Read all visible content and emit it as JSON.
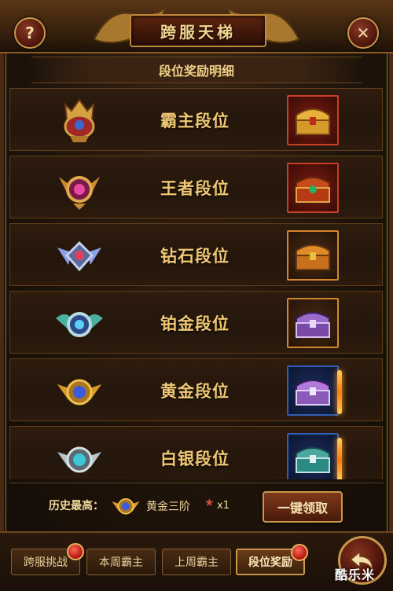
{
  "window": {
    "title": "跨服天梯"
  },
  "section": {
    "title": "段位奖励明细"
  },
  "ranks": [
    {
      "label": "霸主段位",
      "emblem": "overlord-emblem-icon",
      "chest": "gold-chest-icon",
      "frame": "red"
    },
    {
      "label": "王者段位",
      "emblem": "king-emblem-icon",
      "chest": "jeweled-chest-icon",
      "frame": "red"
    },
    {
      "label": "钻石段位",
      "emblem": "diamond-emblem-icon",
      "chest": "orange-chest-icon",
      "frame": "orange"
    },
    {
      "label": "铂金段位",
      "emblem": "platinum-emblem-icon",
      "chest": "purple-chest-icon",
      "frame": "orange"
    },
    {
      "label": "黄金段位",
      "emblem": "gold-emblem-icon",
      "chest": "purple-chest-icon",
      "frame": "blue"
    },
    {
      "label": "白银段位",
      "emblem": "silver-emblem-icon",
      "chest": "teal-chest-icon",
      "frame": "blue"
    }
  ],
  "history": {
    "label": "历史最高：",
    "rank": "黄金三阶",
    "star": "★",
    "count": "x1"
  },
  "claim_button": "一键领取",
  "tabs": [
    {
      "label": "跨服挑战",
      "badge": true,
      "active": false
    },
    {
      "label": "本周霸主",
      "badge": false,
      "active": false
    },
    {
      "label": "上周霸主",
      "badge": false,
      "active": false
    },
    {
      "label": "段位奖励",
      "badge": true,
      "active": true
    }
  ],
  "watermark": "酷乐米",
  "colors": {
    "accent": "#c9974a",
    "text_gold": "#f0c874",
    "badge_red": "#b3120b"
  }
}
